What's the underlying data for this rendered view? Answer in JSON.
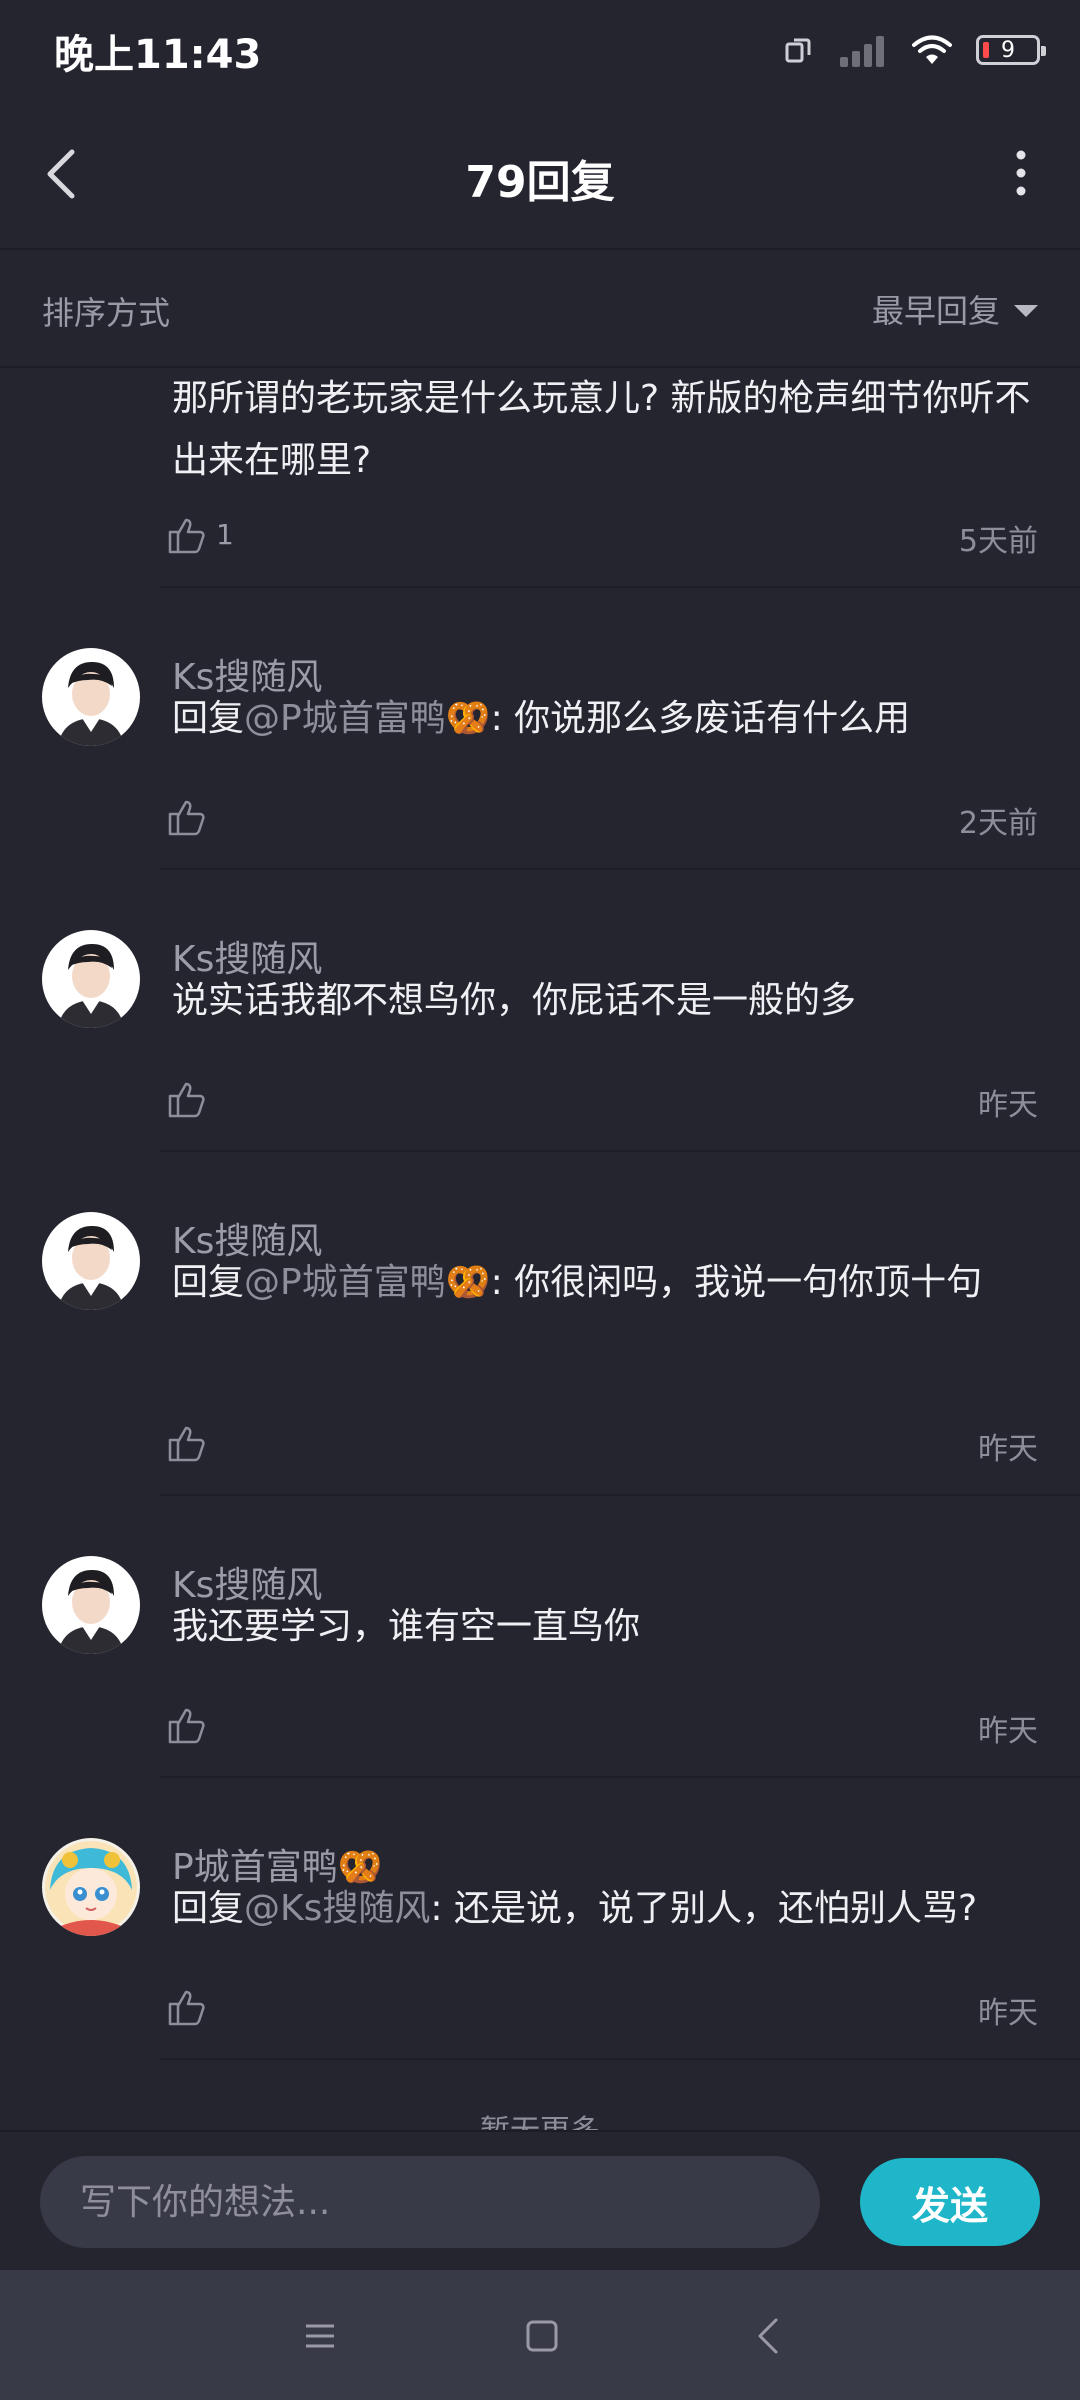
{
  "status_bar": {
    "time": "晚上11:43",
    "battery": "9"
  },
  "header": {
    "title": "79回复"
  },
  "sort": {
    "label": "排序方式",
    "current": "最早回复"
  },
  "comments": [
    {
      "text": "那所谓的老玩家是什么玩意儿? 新版的枪声细节你听不出来在哪里?",
      "likes": "1",
      "time": "5天前"
    },
    {
      "user": "Ks搜随风",
      "prefix": "回复",
      "mention": "@P城首富鸭🥨",
      "text": ": 你说那么多废话有什么用",
      "time": "2天前"
    },
    {
      "user": "Ks搜随风",
      "text": "说实话我都不想鸟你，你屁话不是一般的多",
      "time": "昨天"
    },
    {
      "user": "Ks搜随风",
      "prefix": "回复",
      "mention": "@P城首富鸭🥨",
      "text": ": 你很闲吗，我说一句你顶十句",
      "time": "昨天"
    },
    {
      "user": "Ks搜随风",
      "text": "我还要学习，谁有空一直鸟你",
      "time": "昨天"
    },
    {
      "user": "P城首富鸭🥨",
      "prefix": "回复",
      "mention": "@Ks搜随风",
      "text": ": 还是说，说了别人，还怕别人骂?",
      "time": "昨天"
    }
  ],
  "no_more": "暂无更多",
  "input": {
    "placeholder": "写下你的想法...",
    "send": "发送"
  },
  "colors": {
    "background": "#252530",
    "accent": "#1eb6c8",
    "input_bg": "#393a48"
  },
  "icons": [
    "back-icon",
    "more-icon",
    "like-icon",
    "menu-icon",
    "home-icon",
    "nav-back-icon"
  ]
}
